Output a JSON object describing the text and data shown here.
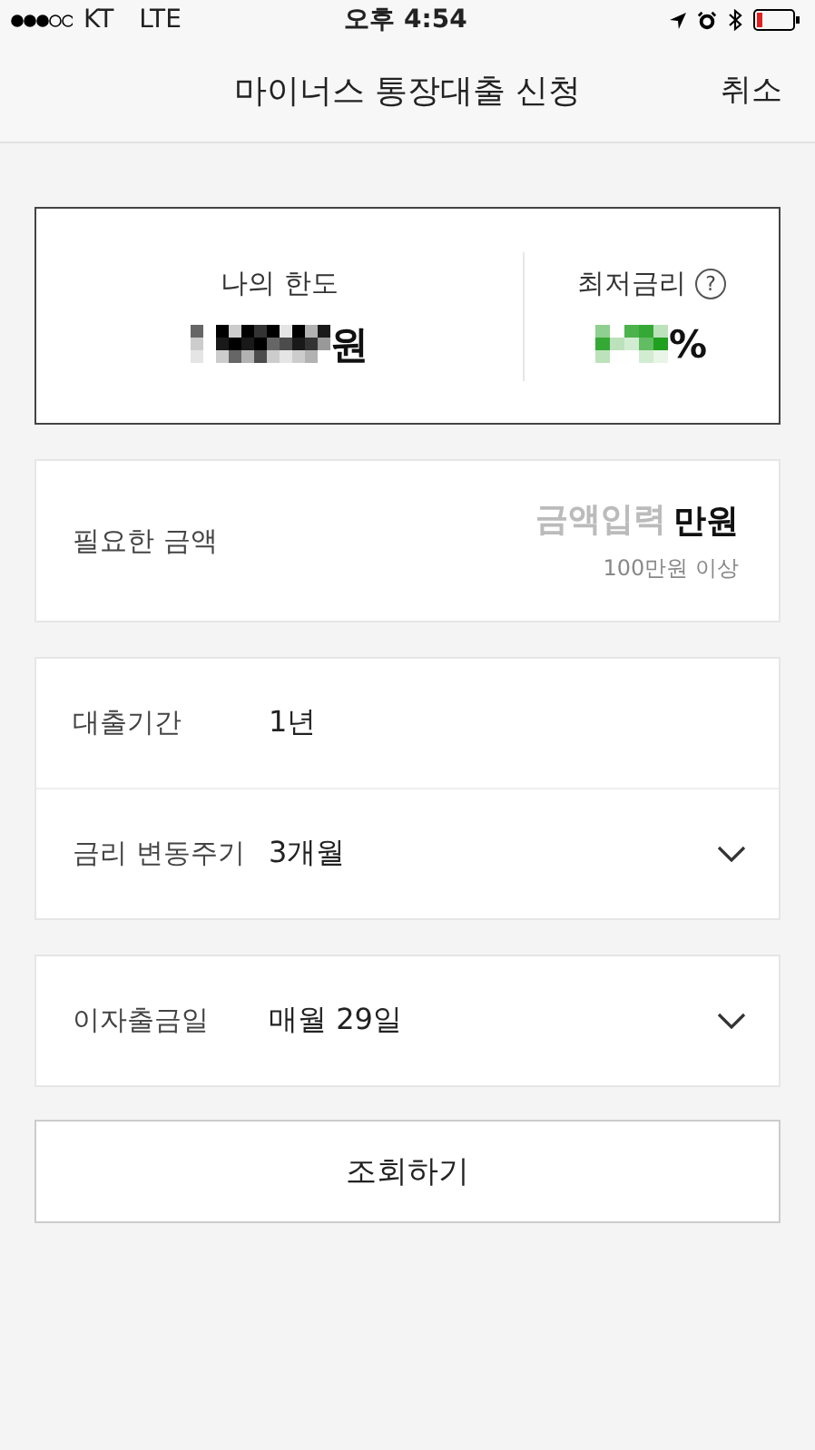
{
  "status_bar": {
    "carrier": "KT",
    "network": "LTE",
    "time": "오후 4:54"
  },
  "nav": {
    "title": "마이너스 통장대출 신청",
    "cancel": "취소"
  },
  "summary": {
    "limit_label": "나의 한도",
    "limit_redacted": true,
    "limit_unit": "원",
    "rate_label": "최저금리",
    "rate_help": "?",
    "rate_redacted": true,
    "rate_unit": "%"
  },
  "amount": {
    "label": "필요한 금액",
    "placeholder": "금액입력",
    "unit": "만원",
    "hint": "100만원 이상"
  },
  "groups": [
    [
      {
        "label": "대출기간",
        "value": "1년",
        "kind": "static"
      },
      {
        "label": "금리 변동주기",
        "value": "3개월",
        "kind": "dropdown"
      }
    ],
    [
      {
        "label": "이자출금일",
        "value": "매월 29일",
        "kind": "dropdown"
      }
    ]
  ],
  "submit": "조회하기"
}
